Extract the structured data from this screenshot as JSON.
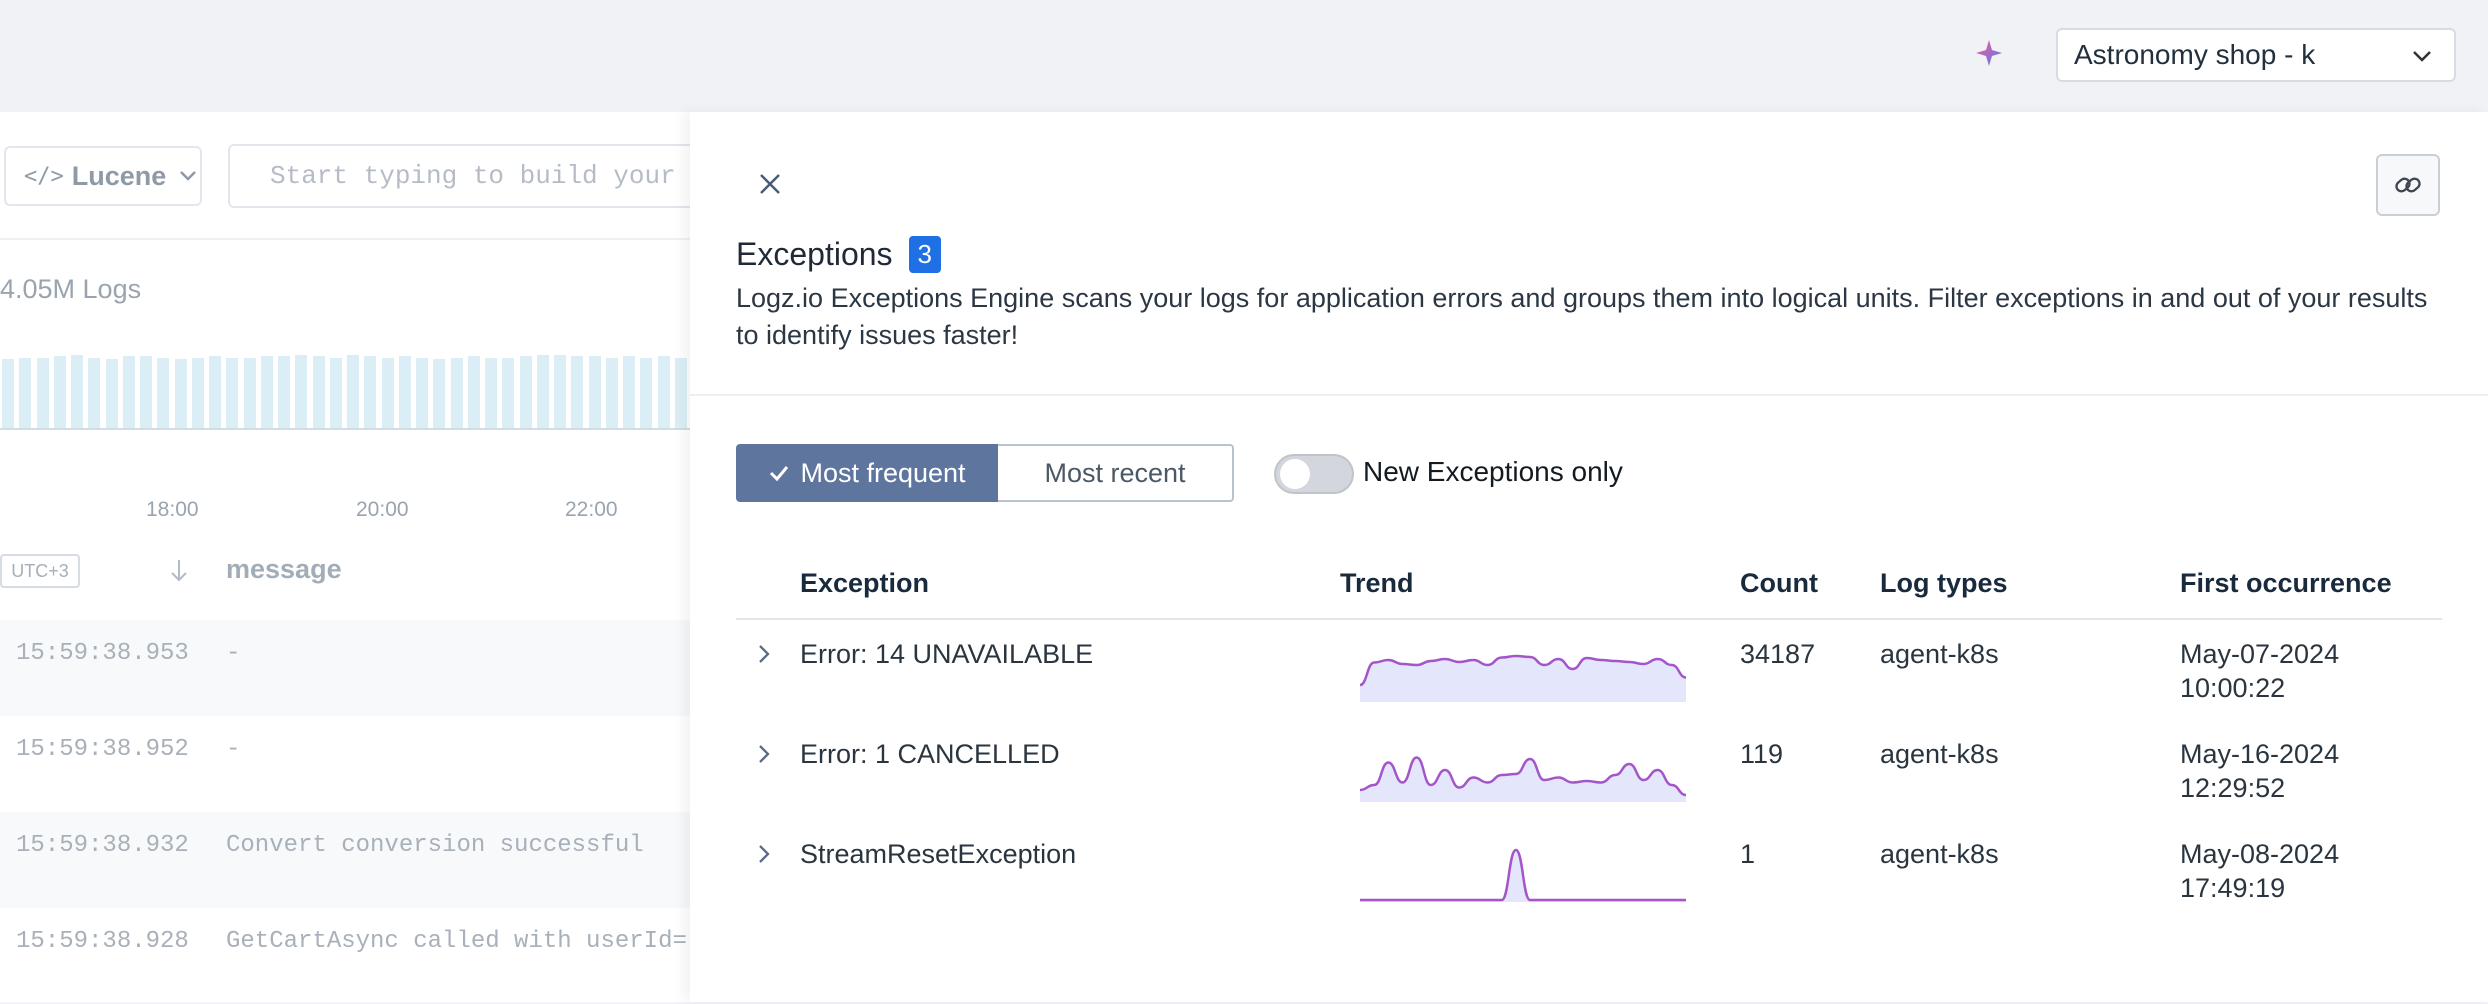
{
  "header": {
    "account_name": "Astronomy shop - k",
    "accent_color": "#6a7cf0"
  },
  "explorer": {
    "query_language": "Lucene",
    "query_placeholder": "Start typing to build your query",
    "logs_count": "4.05M Logs",
    "histogram_levels": [
      0.88,
      0.9,
      0.9,
      0.92,
      0.94,
      0.9,
      0.88,
      0.92,
      0.92,
      0.9,
      0.88,
      0.9,
      0.92,
      0.9,
      0.9,
      0.92,
      0.92,
      0.94,
      0.92,
      0.9,
      0.94,
      0.92,
      0.9,
      0.92,
      0.9,
      0.88,
      0.9,
      0.92,
      0.9,
      0.9,
      0.92,
      0.94,
      0.94,
      0.92,
      0.92,
      0.9,
      0.92,
      0.9,
      0.92,
      0.9
    ],
    "time_ticks": [
      "18:00",
      "20:00",
      "22:00"
    ],
    "timezone": "UTC+3",
    "message_column": "message",
    "rows": [
      {
        "timestamp": "15:59:38.953",
        "message": "-"
      },
      {
        "timestamp": "15:59:38.952",
        "message": "-"
      },
      {
        "timestamp": "15:59:38.932",
        "message": "Convert conversion successful"
      },
      {
        "timestamp": "15:59:38.928",
        "message": "GetCartAsync called with userId="
      }
    ]
  },
  "drawer": {
    "title": "Exceptions",
    "count": "3",
    "description": "Logz.io Exceptions Engine scans your logs for application errors and groups them into logical units. Filter exceptions in and out of your results to identify issues faster!",
    "sort_most_frequent": "Most frequent",
    "sort_most_recent": "Most recent",
    "toggle_label": "New Exceptions only",
    "columns": {
      "exception": "Exception",
      "trend": "Trend",
      "count": "Count",
      "log_types": "Log types",
      "first_occurrence": "First occurrence"
    },
    "trend_color": "#a355c9",
    "trend_fill": "#e4e7fb",
    "rows": [
      {
        "exception": "Error: 14 UNAVAILABLE",
        "count": "34187",
        "log_type": "agent-k8s",
        "first_date": "May-07-2024",
        "first_time": "10:00:22",
        "trend": [
          0.3,
          0.75,
          0.8,
          0.72,
          0.7,
          0.78,
          0.82,
          0.76,
          0.8,
          0.7,
          0.85,
          0.88,
          0.86,
          0.7,
          0.82,
          0.62,
          0.84,
          0.8,
          0.78,
          0.76,
          0.72,
          0.82,
          0.7,
          0.45
        ]
      },
      {
        "exception": "Error: 1 CANCELLED",
        "count": "119",
        "log_type": "agent-k8s",
        "first_date": "May-16-2024",
        "first_time": "12:29:52",
        "trend": [
          0.2,
          0.3,
          0.75,
          0.35,
          0.85,
          0.3,
          0.6,
          0.25,
          0.45,
          0.35,
          0.5,
          0.52,
          0.82,
          0.4,
          0.45,
          0.35,
          0.38,
          0.35,
          0.5,
          0.72,
          0.4,
          0.6,
          0.3,
          0.1
        ]
      },
      {
        "exception": "StreamResetException",
        "count": "1",
        "log_type": "agent-k8s",
        "first_date": "May-08-2024",
        "first_time": "17:49:19",
        "trend": [
          0,
          0,
          0,
          0,
          0,
          0,
          0,
          0,
          0,
          0,
          0,
          1,
          0,
          0,
          0,
          0,
          0,
          0,
          0,
          0,
          0,
          0,
          0,
          0
        ]
      }
    ]
  }
}
